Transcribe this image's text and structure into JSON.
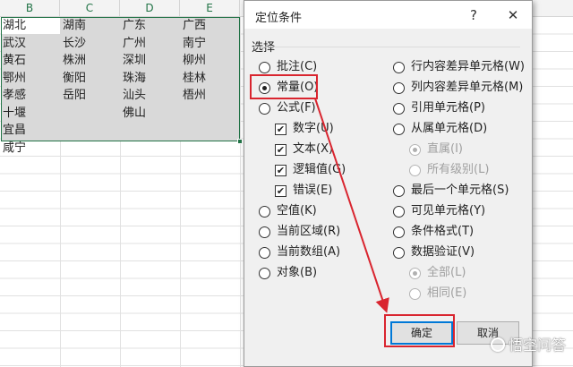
{
  "sheet": {
    "columns": [
      "B",
      "C",
      "D",
      "E"
    ],
    "rows": [
      [
        "湖北",
        "湖南",
        "广东",
        "广西"
      ],
      [
        "武汉",
        "长沙",
        "广州",
        "南宁"
      ],
      [
        "黄石",
        "株洲",
        "深圳",
        "柳州"
      ],
      [
        "鄂州",
        "衡阳",
        "珠海",
        "桂林"
      ],
      [
        "孝感",
        "岳阳",
        "汕头",
        "梧州"
      ],
      [
        "十堰",
        "",
        "佛山",
        ""
      ],
      [
        "宜昌",
        "",
        "",
        ""
      ],
      [
        "咸宁",
        "",
        "",
        ""
      ]
    ],
    "colors": {
      "accent": "#217346",
      "selection": "#d9d9d9"
    }
  },
  "dialog": {
    "title": "定位条件",
    "help": "?",
    "close": "✕",
    "group_label": "选择",
    "left_options": [
      {
        "label": "批注(C)",
        "checked": false
      },
      {
        "label": "常量(O)",
        "checked": true
      },
      {
        "label": "公式(F)",
        "checked": false
      }
    ],
    "formula_checks": [
      {
        "label": "数字(U)",
        "checked": true
      },
      {
        "label": "文本(X)",
        "checked": true
      },
      {
        "label": "逻辑值(G)",
        "checked": true
      },
      {
        "label": "错误(E)",
        "checked": true
      }
    ],
    "left_options_more": [
      {
        "label": "空值(K)",
        "checked": false
      },
      {
        "label": "当前区域(R)",
        "checked": false
      },
      {
        "label": "当前数组(A)",
        "checked": false
      },
      {
        "label": "对象(B)",
        "checked": false
      }
    ],
    "right_options": [
      {
        "label": "行内容差异单元格(W)",
        "checked": false,
        "disabled": false
      },
      {
        "label": "列内容差异单元格(M)",
        "checked": false,
        "disabled": false
      },
      {
        "label": "引用单元格(P)",
        "checked": false,
        "disabled": false
      },
      {
        "label": "从属单元格(D)",
        "checked": false,
        "disabled": false
      },
      {
        "label": "直属(I)",
        "checked": true,
        "disabled": true
      },
      {
        "label": "所有级别(L)",
        "checked": false,
        "disabled": true
      },
      {
        "label": "最后一个单元格(S)",
        "checked": false,
        "disabled": false
      },
      {
        "label": "可见单元格(Y)",
        "checked": false,
        "disabled": false
      },
      {
        "label": "条件格式(T)",
        "checked": false,
        "disabled": false
      },
      {
        "label": "数据验证(V)",
        "checked": false,
        "disabled": false
      },
      {
        "label": "全部(L)",
        "checked": true,
        "disabled": true
      },
      {
        "label": "相同(E)",
        "checked": false,
        "disabled": true
      }
    ],
    "ok_label": "确定",
    "cancel_label": "取消",
    "highlight_color": "#d9252f",
    "default_button_color": "#0078d7"
  },
  "watermark": {
    "text": "悟空问答"
  }
}
